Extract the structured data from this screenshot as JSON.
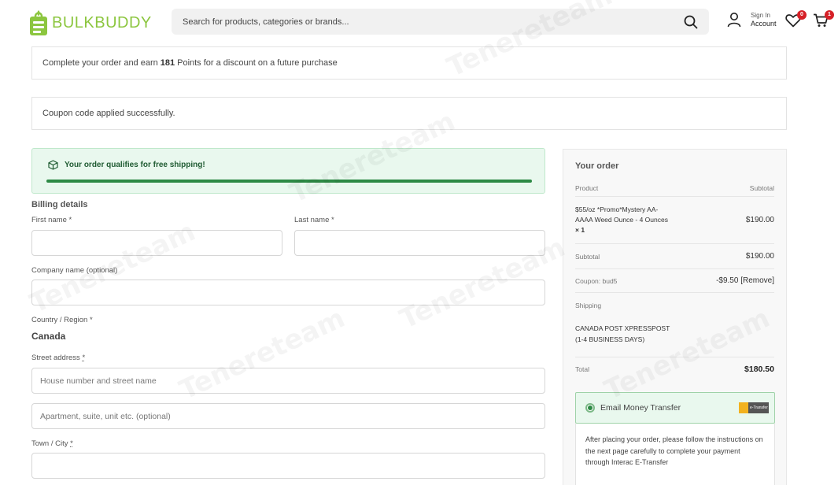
{
  "header": {
    "logo_text": "BULKBUDDY",
    "search_placeholder": "Search for products, categories or brands...",
    "account_small": "Sign In",
    "account_big": "Account",
    "wishlist_count": "0",
    "cart_count": "1"
  },
  "notices": {
    "points_before": "Complete your order and earn",
    "points_value": "181",
    "points_after": "Points for a discount on a future purchase",
    "coupon_msg": "Coupon code applied successfully."
  },
  "shipping_notice": {
    "message": "Your order qualifies for free shipping!",
    "progress": 1.0
  },
  "billing": {
    "title": "Billing details",
    "first_name_label": "First name",
    "last_name_label": "Last name",
    "company_label": "Company name (optional)",
    "country_label": "Country / Region",
    "country_value": "Canada",
    "street_label": "Street address",
    "street_placeholder": "House number and street name",
    "apartment_placeholder": "Apartment, suite, unit etc. (optional)",
    "town_label": "Town / City",
    "required_mark": "*"
  },
  "order": {
    "title": "Your order",
    "col_product": "Product",
    "col_subtotal": "Subtotal",
    "product_name": "$55/oz *Promo*Mystery AA-AAAA Weed Ounce - 4 Ounces",
    "product_qty": "× 1",
    "product_price": "$190.00",
    "subtotal_label": "Subtotal",
    "subtotal_value": "$190.00",
    "coupon_label": "Coupon: bud5",
    "coupon_value": "-$9.50",
    "coupon_remove": "[Remove]",
    "shipping_label": "Shipping",
    "shipping_method_line1": "CANADA POST XPRESSPOST",
    "shipping_method_line2": "(1-4 BUSINESS DAYS)",
    "total_label": "Total",
    "total_value": "$180.50"
  },
  "payment": {
    "method_label": "Email Money Transfer",
    "logo_text": "e-Transfer",
    "description": "After placing your order, please follow the instructions on the next page carefully to complete your payment through Interac E-Transfer"
  },
  "watermark": "Tenereteam",
  "colors": {
    "brand_green": "#8cc63f",
    "success_green": "#2d8a45",
    "badge_red": "#d62027"
  }
}
